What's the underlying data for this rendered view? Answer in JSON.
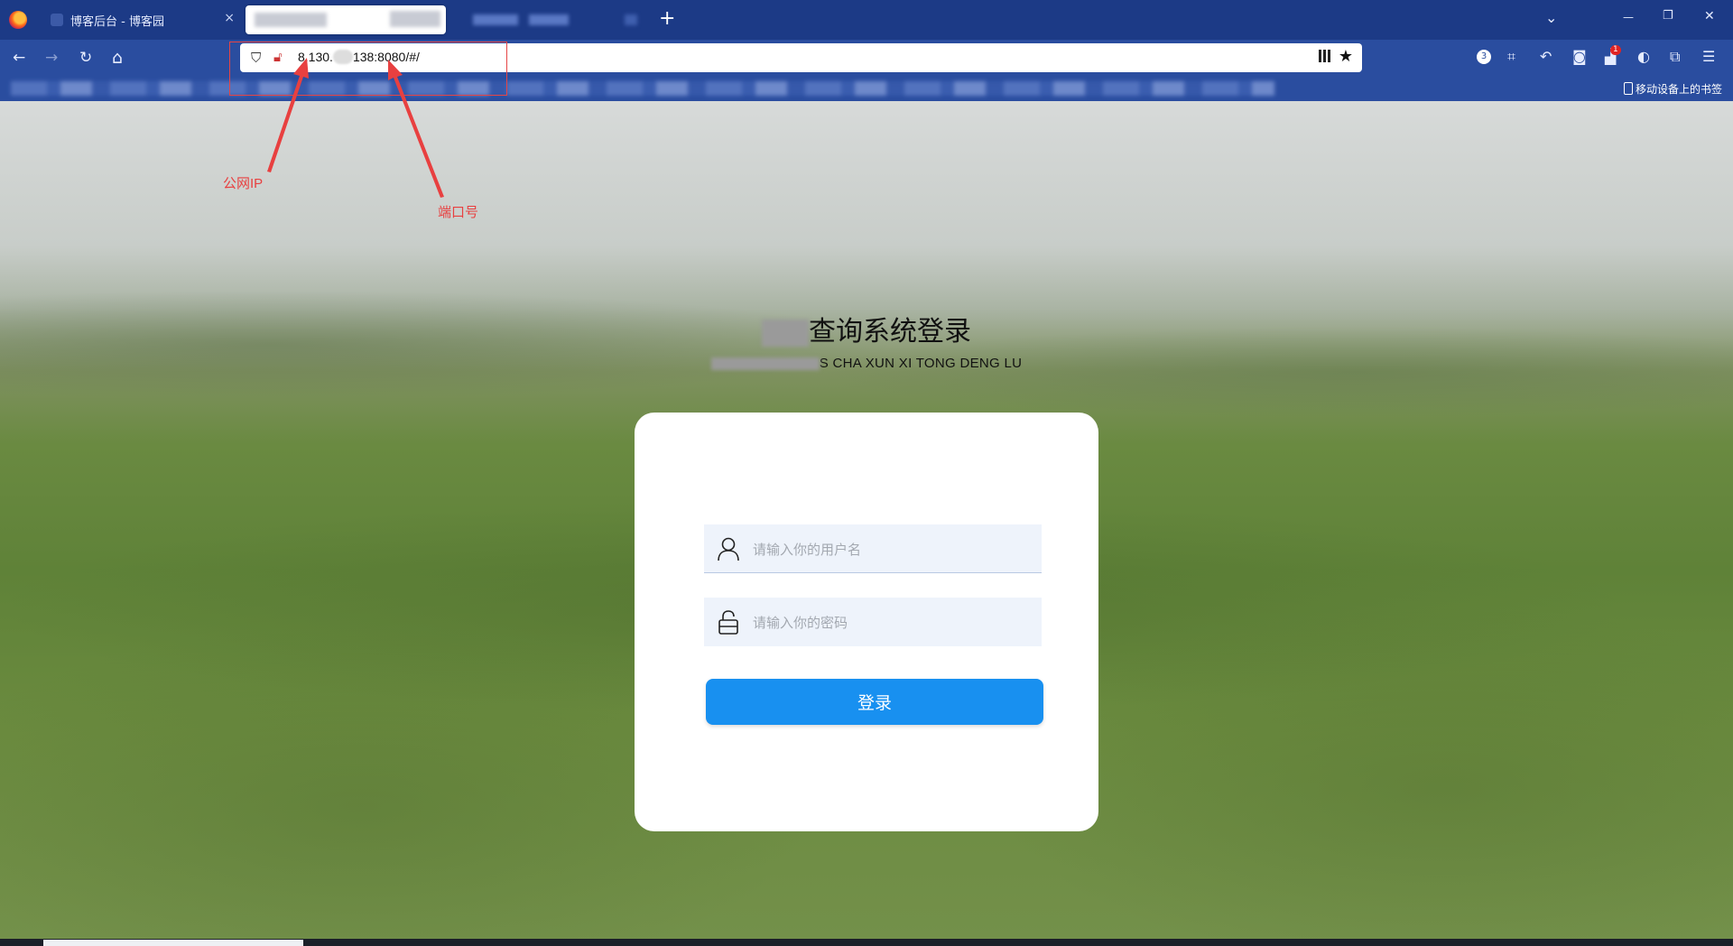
{
  "tabs": [
    {
      "title": "博客后台 - 博客园",
      "close": "×"
    },
    {
      "title": ""
    },
    {
      "title": ""
    }
  ],
  "toolbar": {
    "new_tab": "+",
    "back": "←",
    "forward": "→",
    "reload": "↻",
    "home": "⌂"
  },
  "window_controls": {
    "list": "⌄",
    "minimize": "—",
    "restore": "❐",
    "close": "✕"
  },
  "address_bar": {
    "url_prefix": "8.130.",
    "url_suffix": "138:8080/#/"
  },
  "extensions": {
    "badge_circle": "3",
    "badge_red": "1"
  },
  "bookmarks": {
    "mobile_label": "移动设备上的书签"
  },
  "annotations": {
    "ip_label": "公网IP",
    "port_label": "端口号",
    "color": "#e84040"
  },
  "login": {
    "title_visible": "查询系统登录",
    "subtitle_visible": "S CHA XUN XI TONG DENG LU",
    "username_placeholder": "请输入你的用户名",
    "password_placeholder": "请输入你的密码",
    "login_button": "登录",
    "accent_color": "#1890f0"
  },
  "icons": {
    "user": "person-icon",
    "password": "padlock-icon",
    "shield": "shield-icon",
    "lock": "lock-icon",
    "star": "star-icon",
    "qr": "qr-code-icon"
  }
}
